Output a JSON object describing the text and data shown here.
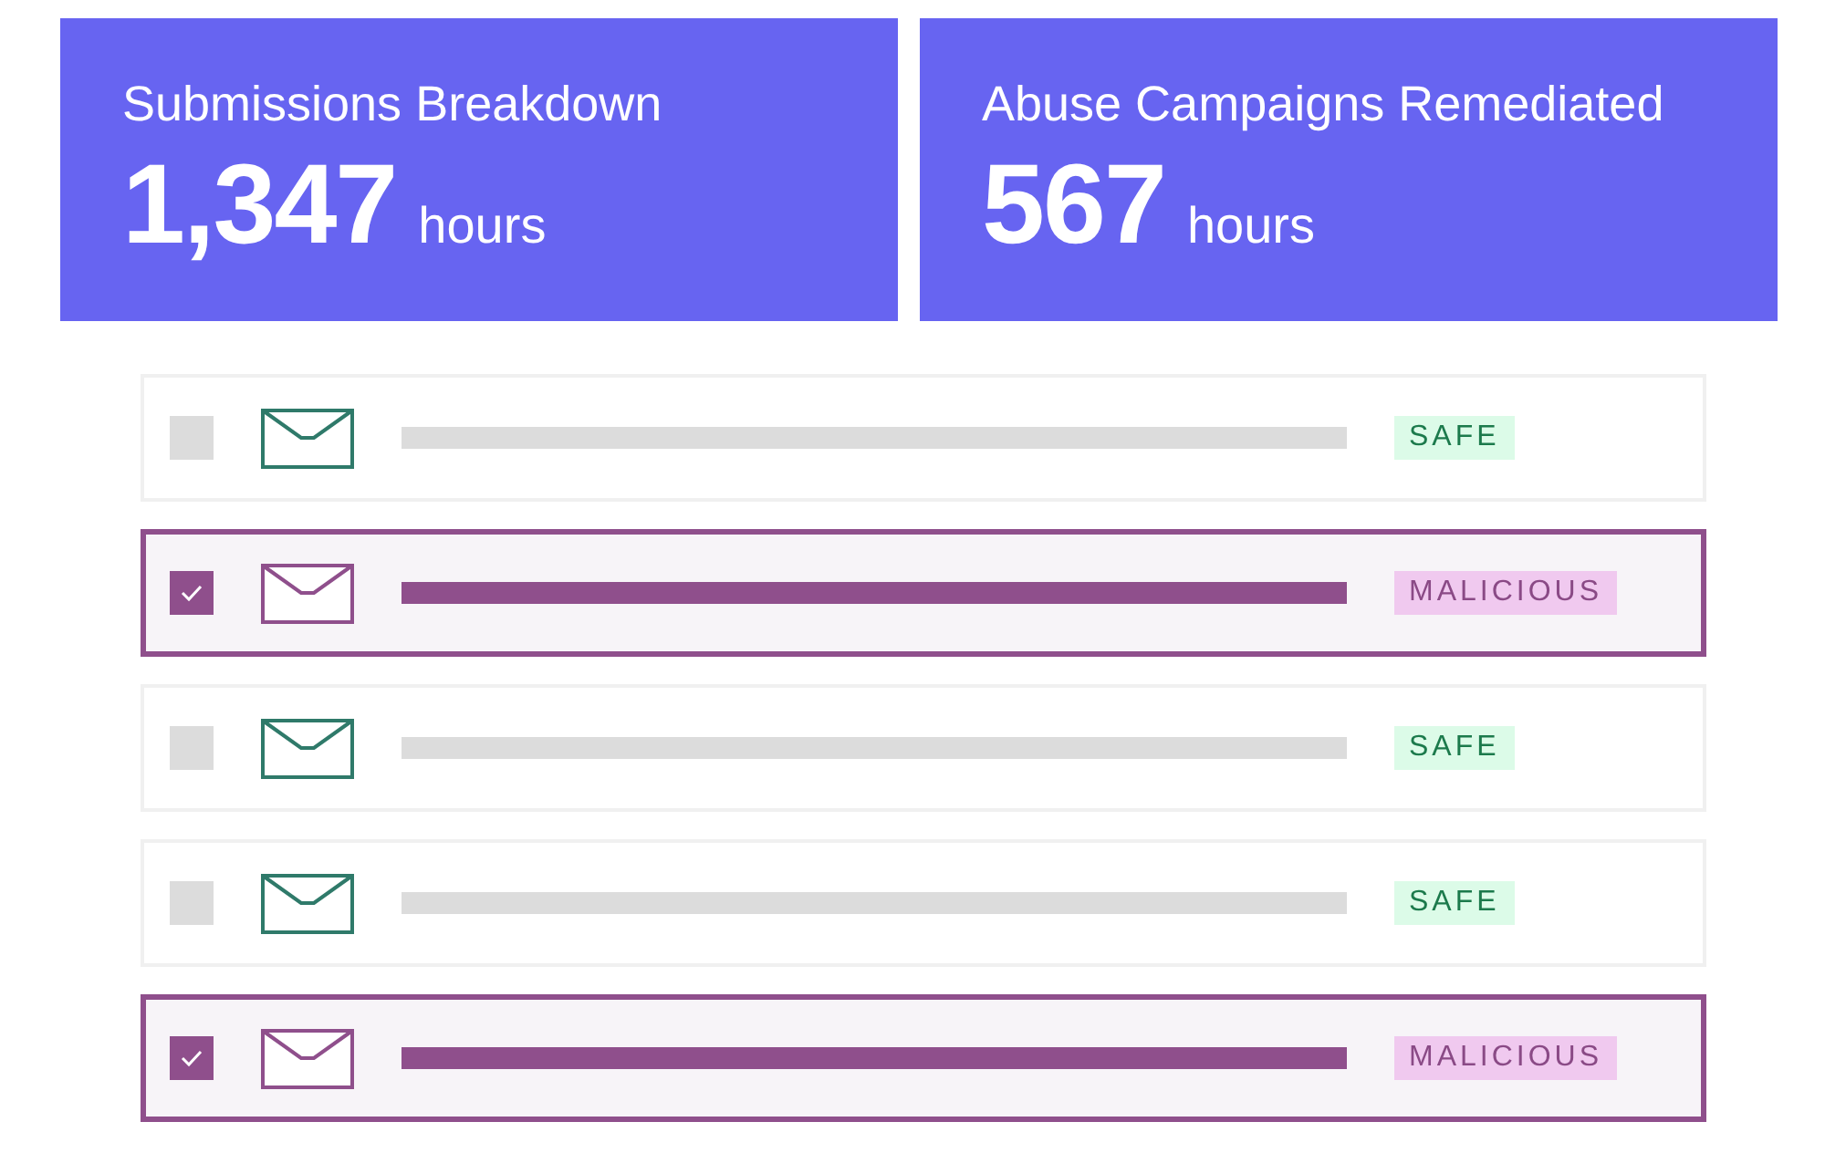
{
  "stats": [
    {
      "title": "Submissions Breakdown",
      "value": "1,347",
      "unit": "hours"
    },
    {
      "title": "Abuse Campaigns Remediated",
      "value": "567",
      "unit": "hours"
    }
  ],
  "emails": [
    {
      "checked": false,
      "kind": "safe",
      "verdict": "SAFE"
    },
    {
      "checked": true,
      "kind": "malicious",
      "verdict": "MALICIOUS"
    },
    {
      "checked": false,
      "kind": "safe",
      "verdict": "SAFE"
    },
    {
      "checked": false,
      "kind": "safe",
      "verdict": "SAFE"
    },
    {
      "checked": true,
      "kind": "malicious",
      "verdict": "MALICIOUS"
    }
  ]
}
